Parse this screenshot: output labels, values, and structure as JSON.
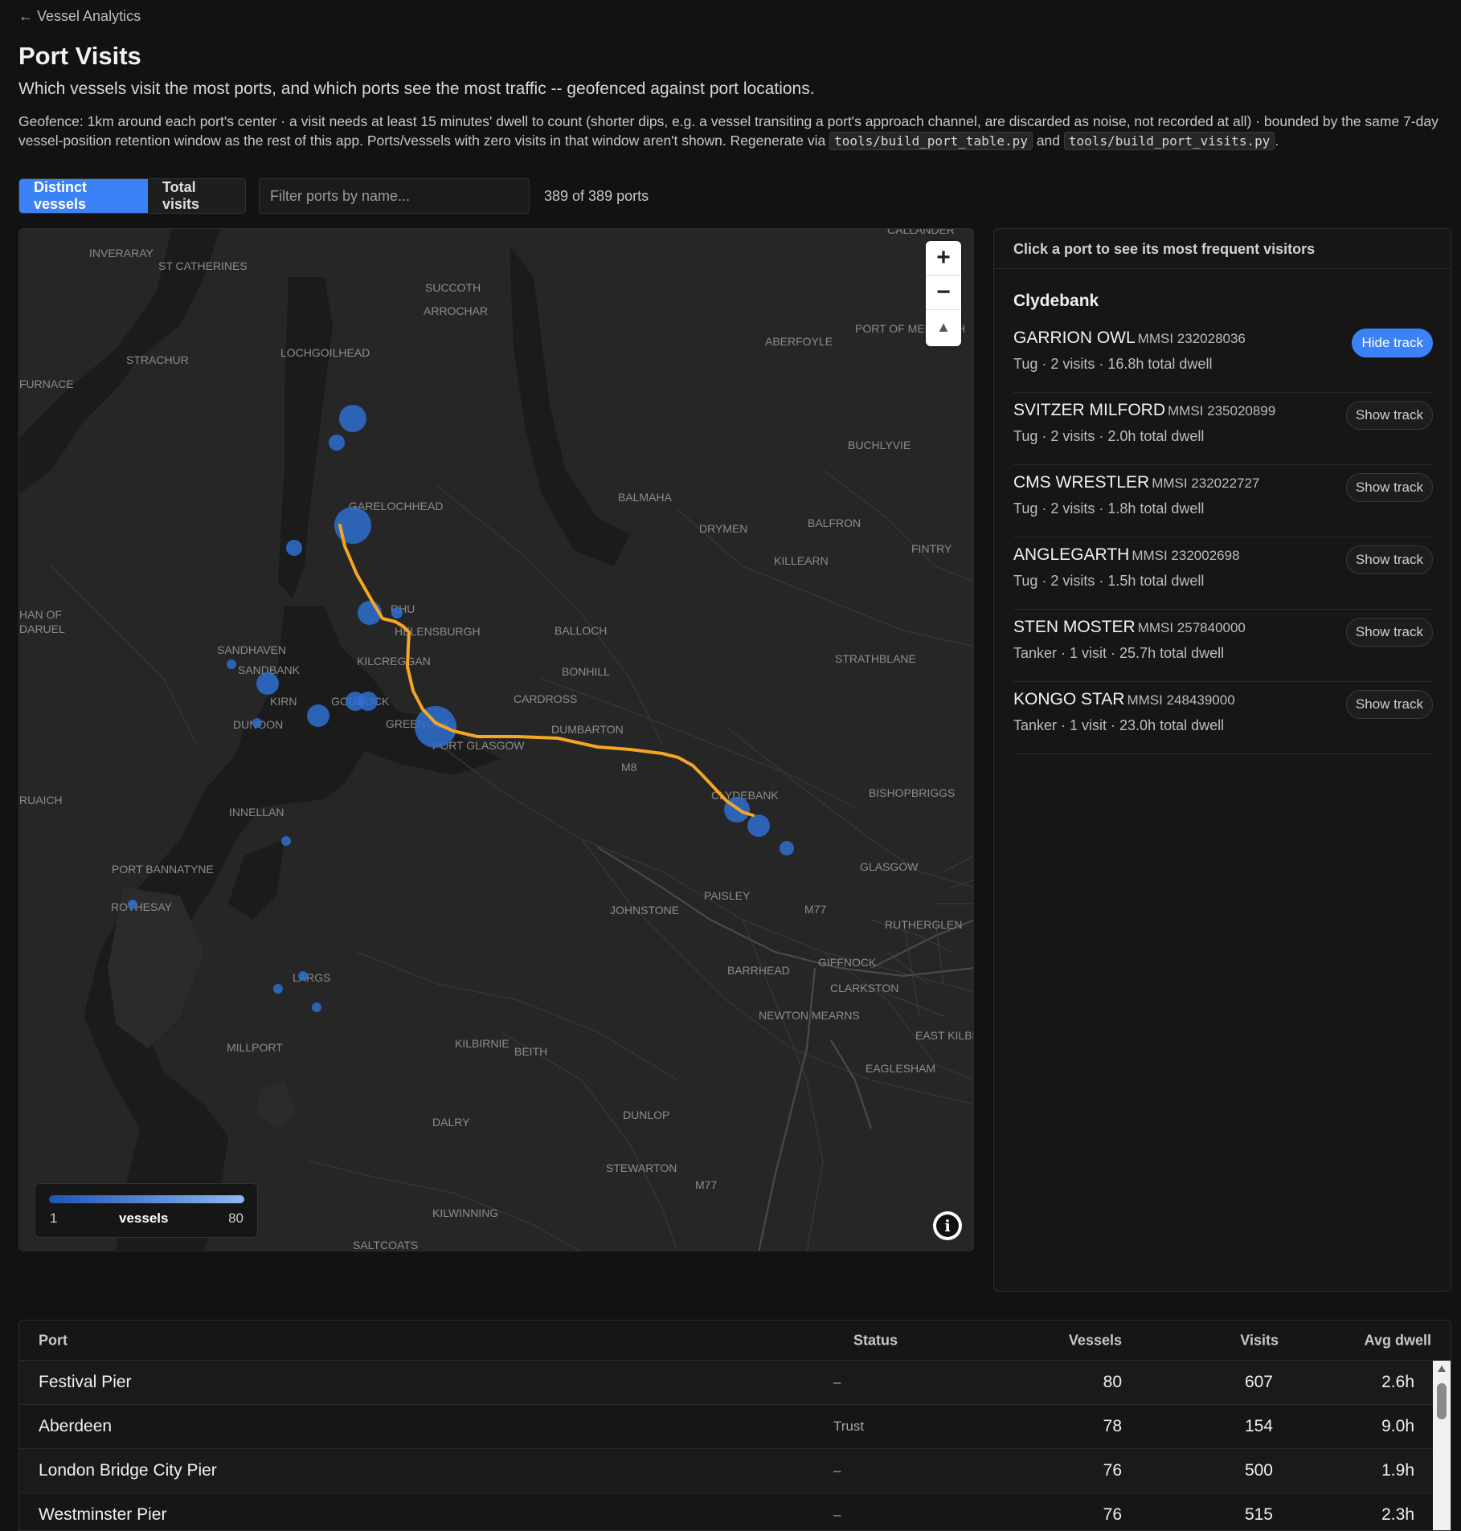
{
  "nav": {
    "back_label": "← Vessel Analytics"
  },
  "header": {
    "title": "Port Visits",
    "subtitle": "Which vessels visit the most ports, and which ports see the most traffic -- geofenced against port locations.",
    "geofence_text_1": "Geofence: 1km around each port's center · a visit needs at least 15 minutes' dwell to count (shorter dips, e.g. a vessel transiting a port's approach channel, are discarded as noise, not recorded at all) · bounded by the same 7-day vessel-position retention window as the rest of this app. Ports/vessels with zero visits in that window aren't shown. Regenerate via ",
    "code_1": "tools/build_port_table.py",
    "geofence_and": " and ",
    "code_2": "tools/build_port_visits.py",
    "geofence_end": "."
  },
  "controls": {
    "mode_options": [
      "Distinct vessels",
      "Total visits"
    ],
    "selected_mode": "Distinct vessels",
    "filter_placeholder": "Filter ports by name...",
    "filter_value": "",
    "port_count": "389 of 389 ports"
  },
  "map": {
    "zoom_in": "+",
    "zoom_out": "−",
    "compass": "▲",
    "legend": {
      "min": "1",
      "label": "vessels",
      "max": "80"
    },
    "colors": {
      "bubble": "#2f6fcf",
      "track": "#f5a623",
      "land": "#262626",
      "water": "#1a1a1a"
    },
    "place_labels": [
      "INVERARAY",
      "ST CATHERINES",
      "SUCCOTH",
      "ARROCHAR",
      "LOCHGOILHEAD",
      "STRACHUR",
      "FURNACE",
      "ABERFOYLE",
      "PORT OF MENTEITH",
      "CALLANDER",
      "BUCHLYVIE",
      "GARELOCHHEAD",
      "BALMAHA",
      "DRYMEN",
      "BALFRON",
      "FINTRY",
      "KILLEARN",
      "RHU",
      "HELENSBURGH",
      "BALLOCH",
      "STRATHBLANE",
      "SANDHAVEN",
      "SANDBANK",
      "KILCREGGAN",
      "BONHILL",
      "KIRN",
      "GOUROCK",
      "CARDROSS",
      "DUNOON",
      "GREENOCK",
      "DUMBARTON",
      "PORT GLASGOW",
      "M8",
      "CLYDEBANK",
      "BISHOPBRIGGS",
      "STRAD OF DARUEL",
      "RUAICH",
      "INNELLAN",
      "GLASGOW",
      "PORT BANNATYNE",
      "PAISLEY",
      "ROTHESAY",
      "JOHNSTONE",
      "M77",
      "RUTHERGLEN",
      "GIFFNOCK",
      "BARRHEAD",
      "CLARKSTON",
      "LARGS",
      "NEWTON MEARNS",
      "EAST KILBRIDE",
      "MILLPORT",
      "KILBIRNIE",
      "BEITH",
      "EAGLESHAM",
      "DALRY",
      "DUNLOP",
      "STEWARTON",
      "KILWINNING",
      "SALTCOATS"
    ]
  },
  "side_panel": {
    "header": "Click a port to see its most frequent visitors",
    "port_name": "Clydebank",
    "vessels": [
      {
        "name": "GARRION OWL",
        "mmsi": "MMSI 232028036",
        "meta": "Tug · 2 visits · 16.8h total dwell",
        "button": "Hide track",
        "active": true
      },
      {
        "name": "SVITZER MILFORD",
        "mmsi": "MMSI 235020899",
        "meta": "Tug · 2 visits · 2.0h total dwell",
        "button": "Show track",
        "active": false
      },
      {
        "name": "CMS WRESTLER",
        "mmsi": "MMSI 232022727",
        "meta": "Tug · 2 visits · 1.8h total dwell",
        "button": "Show track",
        "active": false
      },
      {
        "name": "ANGLEGARTH",
        "mmsi": "MMSI 232002698",
        "meta": "Tug · 2 visits · 1.5h total dwell",
        "button": "Show track",
        "active": false
      },
      {
        "name": "STEN MOSTER",
        "mmsi": "MMSI 257840000",
        "meta": "Tanker · 1 visit · 25.7h total dwell",
        "button": "Show track",
        "active": false
      },
      {
        "name": "KONGO STAR",
        "mmsi": "MMSI 248439000",
        "meta": "Tanker · 1 visit · 23.0h total dwell",
        "button": "Show track",
        "active": false
      }
    ]
  },
  "table": {
    "columns": [
      "Port",
      "Status",
      "Vessels",
      "Visits",
      "Avg dwell"
    ],
    "rows": [
      {
        "port": "Festival Pier",
        "status": "–",
        "vessels": "80",
        "visits": "607",
        "avg_dwell": "2.6h"
      },
      {
        "port": "Aberdeen",
        "status": "Trust",
        "vessels": "78",
        "visits": "154",
        "avg_dwell": "9.0h"
      },
      {
        "port": "London Bridge City Pier",
        "status": "–",
        "vessels": "76",
        "visits": "500",
        "avg_dwell": "1.9h"
      },
      {
        "port": "Westminster Pier",
        "status": "–",
        "vessels": "76",
        "visits": "515",
        "avg_dwell": "2.3h"
      }
    ]
  }
}
